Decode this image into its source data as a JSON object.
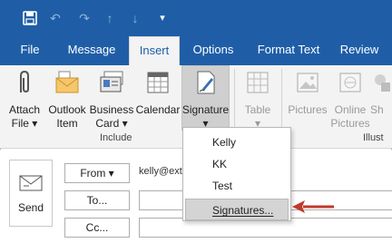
{
  "quick_access": {
    "icons": [
      "save-icon",
      "undo-icon",
      "redo-icon",
      "up-arrow-icon",
      "down-arrow-icon",
      "customize-icon"
    ]
  },
  "tabs": [
    {
      "label": "File",
      "active": false
    },
    {
      "label": "Message",
      "active": false
    },
    {
      "label": "Insert",
      "active": true
    },
    {
      "label": "Options",
      "active": false
    },
    {
      "label": "Format Text",
      "active": false
    },
    {
      "label": "Review",
      "active": false
    }
  ],
  "ribbon": {
    "include_group": {
      "label": "Include",
      "attach_file": {
        "line1": "Attach",
        "line2": "File ▾",
        "icon": "paperclip-icon"
      },
      "outlook_item": {
        "line1": "Outlook",
        "line2": "Item",
        "icon": "envelope-icon"
      },
      "business_card": {
        "line1": "Business",
        "line2": "Card ▾",
        "icon": "business-card-icon"
      },
      "calendar": {
        "line1": "Calendar",
        "icon": "calendar-icon"
      },
      "signature": {
        "line1": "Signature",
        "line2": "▾",
        "icon": "signature-pen-icon"
      }
    },
    "tables_group": {
      "table": {
        "line1": "Table",
        "line2": "▾",
        "icon": "table-icon"
      }
    },
    "illustrations_group": {
      "label": "Illust",
      "pictures": {
        "line1": "Pictures",
        "icon": "picture-icon"
      },
      "online_pictures": {
        "line1": "Online",
        "line2": "Pictures",
        "icon": "online-picture-icon"
      },
      "shapes": {
        "line1": "Sh",
        "icon": "shapes-icon"
      }
    }
  },
  "signature_menu": {
    "items": [
      "Kelly",
      "KK",
      "Test"
    ],
    "manage": "Signatures..."
  },
  "compose": {
    "send_label": "Send",
    "from_label": "From",
    "from_value": "kelly@ext",
    "to_label": "To...",
    "cc_label": "Cc..."
  },
  "colors": {
    "title_bar": "#1f5ea7",
    "ribbon_bg": "#f3f3f3",
    "menu_highlight": "#d4d4d4",
    "arrow": "#c0392b"
  }
}
